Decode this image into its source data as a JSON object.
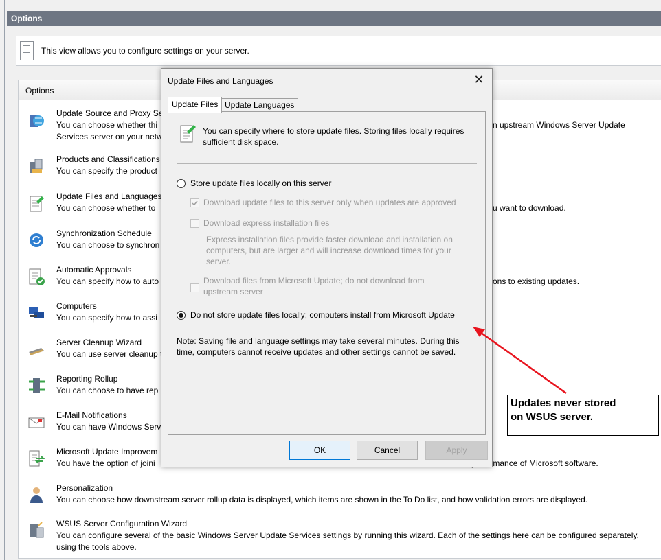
{
  "window": {
    "title": "Options"
  },
  "info": {
    "text": "This view allows you to configure settings on your server."
  },
  "panel": {
    "header": "Options"
  },
  "options": [
    {
      "title": "Update Source and Proxy Se",
      "desc": "You can choose whether thi",
      "desc2": "Services server on your netw",
      "right": "n upstream Windows Server Update"
    },
    {
      "title": "Products and Classifications",
      "desc": "You can specify the product"
    },
    {
      "title": "Update Files and Languages",
      "desc": "You can choose whether to",
      "right": "u want to download."
    },
    {
      "title": "Synchronization Schedule",
      "desc": "You can choose to synchron"
    },
    {
      "title": "Automatic Approvals",
      "desc": "You can specify how to auto",
      "right": "ons to existing updates."
    },
    {
      "title": "Computers",
      "desc": "You can specify how to assi"
    },
    {
      "title": "Server Cleanup Wizard",
      "desc": "You can use server cleanup t"
    },
    {
      "title": "Reporting Rollup",
      "desc": "You can choose to have rep"
    },
    {
      "title": "E-Mail Notifications",
      "desc": "You can have Windows Serv"
    },
    {
      "title": "Microsoft Update Improvem",
      "desc": "You have the option of joini",
      "right": "performance of Microsoft software."
    },
    {
      "title": "Personalization",
      "desc": "You can choose how downstream server rollup data is displayed, which items are shown in the To Do list, and how validation errors are displayed."
    },
    {
      "title": "WSUS Server Configuration Wizard",
      "desc": "You can configure several of the basic Windows Server Update Services settings by running this wizard. Each of the settings here can be configured separately,",
      "desc2": "using the tools above."
    }
  ],
  "dialog": {
    "title": "Update Files and Languages",
    "close": "✕",
    "tabs": [
      "Update Files",
      "Update Languages"
    ],
    "header_text": "You can specify where to store update files. Storing files locally requires sufficient disk space.",
    "radio_local": "Store update files locally on this server",
    "chk_approved": "Download update files to this server only when updates are approved",
    "chk_express": "Download express installation files",
    "express_note": "Express installation files provide faster download and installation on computers, but are larger and will increase download times for your server.",
    "chk_msupdate": "Download files from Microsoft Update; do not download from upstream server",
    "radio_remote": "Do not store update files locally; computers install from Microsoft Update",
    "note": "Note: Saving file and language settings may take several minutes. During this time, computers cannot receive updates and other settings cannot be saved.",
    "buttons": {
      "ok": "OK",
      "cancel": "Cancel",
      "apply": "Apply"
    }
  },
  "callout": {
    "line1": "Updates never stored",
    "line2": "on WSUS server."
  },
  "colors": {
    "titlebar": "#6e7683",
    "arrow": "#e8141e",
    "accent": "#0078d7"
  }
}
